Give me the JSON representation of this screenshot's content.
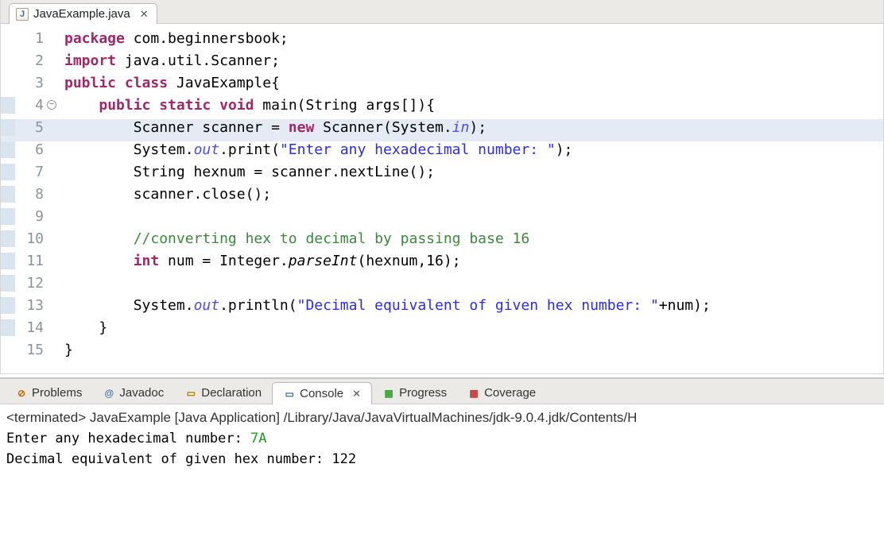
{
  "tab": {
    "filename": "JavaExample.java"
  },
  "code": {
    "lines": [
      {
        "n": 1,
        "tokens": [
          [
            "kw",
            "package"
          ],
          [
            "",
            " com.beginnersbook;"
          ]
        ]
      },
      {
        "n": 2,
        "tokens": [
          [
            "kw",
            "import"
          ],
          [
            "",
            " java.util.Scanner;"
          ]
        ]
      },
      {
        "n": 3,
        "tokens": [
          [
            "kw",
            "public"
          ],
          [
            "",
            " "
          ],
          [
            "kw",
            "class"
          ],
          [
            "",
            " JavaExample{"
          ]
        ]
      },
      {
        "n": 4,
        "fold": true,
        "bluestrip": true,
        "tokens": [
          [
            "",
            "    "
          ],
          [
            "kw",
            "public"
          ],
          [
            "",
            " "
          ],
          [
            "kw",
            "static"
          ],
          [
            "",
            " "
          ],
          [
            "typ",
            "void"
          ],
          [
            "",
            " main(String args[]){"
          ]
        ]
      },
      {
        "n": 5,
        "hl": true,
        "bluestrip": true,
        "tokens": [
          [
            "",
            "        Scanner scanner = "
          ],
          [
            "kw",
            "new"
          ],
          [
            "",
            " Scanner(System."
          ],
          [
            "fld",
            "in"
          ],
          [
            "",
            ");"
          ]
        ]
      },
      {
        "n": 6,
        "bluestrip": true,
        "tokens": [
          [
            "",
            "        System."
          ],
          [
            "fld",
            "out"
          ],
          [
            "",
            ".print("
          ],
          [
            "str",
            "\"Enter any hexadecimal number: \""
          ],
          [
            "",
            ");"
          ]
        ]
      },
      {
        "n": 7,
        "bluestrip": true,
        "tokens": [
          [
            "",
            "        String hexnum = scanner.nextLine();"
          ]
        ]
      },
      {
        "n": 8,
        "bluestrip": true,
        "tokens": [
          [
            "",
            "        scanner.close();"
          ]
        ]
      },
      {
        "n": 9,
        "bluestrip": true,
        "tokens": []
      },
      {
        "n": 10,
        "bluestrip": true,
        "tokens": [
          [
            "",
            "        "
          ],
          [
            "cm",
            "//converting hex to decimal by passing base 16"
          ]
        ]
      },
      {
        "n": 11,
        "bluestrip": true,
        "tokens": [
          [
            "",
            "        "
          ],
          [
            "typ",
            "int"
          ],
          [
            "",
            " num = Integer."
          ],
          [
            "fn-it",
            "parseInt"
          ],
          [
            "",
            "(hexnum,16);"
          ]
        ]
      },
      {
        "n": 12,
        "bluestrip": true,
        "tokens": []
      },
      {
        "n": 13,
        "bluestrip": true,
        "tokens": [
          [
            "",
            "        System."
          ],
          [
            "fld",
            "out"
          ],
          [
            "",
            ".println("
          ],
          [
            "str",
            "\"Decimal equivalent of given hex number: \""
          ],
          [
            "",
            "+num);"
          ]
        ]
      },
      {
        "n": 14,
        "bluestrip": true,
        "tokens": [
          [
            "",
            "    }"
          ]
        ]
      },
      {
        "n": 15,
        "tokens": [
          [
            "",
            "}"
          ]
        ]
      }
    ]
  },
  "views": {
    "tabs": [
      "Problems",
      "Javadoc",
      "Declaration",
      "Console",
      "Progress",
      "Coverage"
    ],
    "active": "Console"
  },
  "console": {
    "status": "<terminated> JavaExample [Java Application] /Library/Java/JavaVirtualMachines/jdk-9.0.4.jdk/Contents/H",
    "line1_prompt": "Enter any hexadecimal number: ",
    "line1_input": "7A",
    "line2": "Decimal equivalent of given hex number: 122"
  }
}
